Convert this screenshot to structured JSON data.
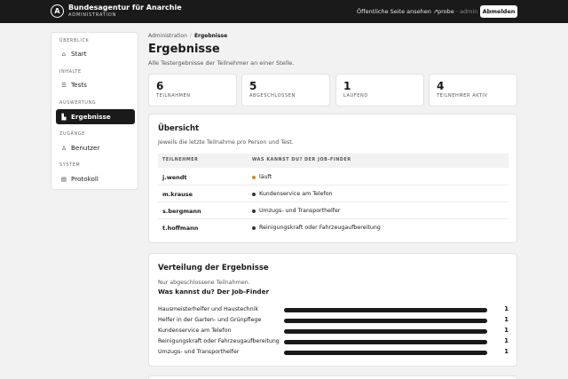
{
  "topbar": {
    "logo_glyph": "A",
    "brand_title": "Bundesagentur für Anarchie",
    "brand_subtitle": "ADMINISTRATION",
    "public_link": "Öffentliche Seite ansehen ↗",
    "user_name": "probe",
    "user_separator": "·",
    "user_role": "admin",
    "logout_label": "Abmelden"
  },
  "sidebar": {
    "sections": [
      {
        "label": "ÜBERBLICK",
        "items": [
          {
            "label": "Start",
            "icon": "home-icon",
            "glyph": "⌂",
            "active": false
          }
        ]
      },
      {
        "label": "INHALTE",
        "items": [
          {
            "label": "Tests",
            "icon": "list-icon",
            "glyph": "☰",
            "active": false
          }
        ]
      },
      {
        "label": "AUSWERTUNG",
        "items": [
          {
            "label": "Ergebnisse",
            "icon": "bar-chart-icon",
            "glyph": "▙",
            "active": true
          }
        ]
      },
      {
        "label": "ZUGÄNGE",
        "items": [
          {
            "label": "Benutzer",
            "icon": "user-icon",
            "glyph": "♙",
            "active": false
          }
        ]
      },
      {
        "label": "SYSTEM",
        "items": [
          {
            "label": "Protokoll",
            "icon": "document-icon",
            "glyph": "▤",
            "active": false
          }
        ]
      }
    ]
  },
  "breadcrumb": {
    "root": "Administration",
    "separator": "/",
    "current": "Ergebnisse"
  },
  "page": {
    "title": "Ergebnisse",
    "subtitle": "Alle Testergebnisse der Teilnehmer an einer Stelle."
  },
  "stats": [
    {
      "value": "6",
      "label": "TEILNAHMEN"
    },
    {
      "value": "5",
      "label": "ABGESCHLOSSEN"
    },
    {
      "value": "1",
      "label": "LAUFEND"
    },
    {
      "value": "4",
      "label": "TEILNEHMER AKTIV"
    }
  ],
  "overview": {
    "title": "Übersicht",
    "subtitle": "Jeweils die letzte Teilnahme pro Person und Test.",
    "columns": [
      "TEILNEHMER",
      "WAS KANNST DU? DER JOB-FINDER"
    ],
    "rows": [
      {
        "name": "j.wendt",
        "result": "läuft",
        "status": "running"
      },
      {
        "name": "m.krause",
        "result": "Kundenservice am Telefon",
        "status": "done"
      },
      {
        "name": "s.bergmann",
        "result": "Umzugs- und Transporthelfer",
        "status": "done"
      },
      {
        "name": "t.hoffmann",
        "result": "Reinigungskraft oder Fahrzeugaufbereitung",
        "status": "done"
      }
    ],
    "status_colors": {
      "running": "#c98a2e",
      "done": "#333333"
    }
  },
  "distribution": {
    "title": "Verteilung der Ergebnisse",
    "subtitle": "Nur abgeschlossene Teilnahmen.",
    "test_title": "Was kannst du? Der Job-Finder",
    "max_count": 1,
    "rows": [
      {
        "label": "Hausmeisterhelfer und Haustechnik",
        "count": 1
      },
      {
        "label": "Helfer in der Garten- und Grünpflege",
        "count": 1
      },
      {
        "label": "Kundenservice am Telefon",
        "count": 1
      },
      {
        "label": "Reinigungskraft oder Fahrzeugaufbereitung",
        "count": 1
      },
      {
        "label": "Umzugs- und Transporthelfer",
        "count": 1
      }
    ]
  }
}
